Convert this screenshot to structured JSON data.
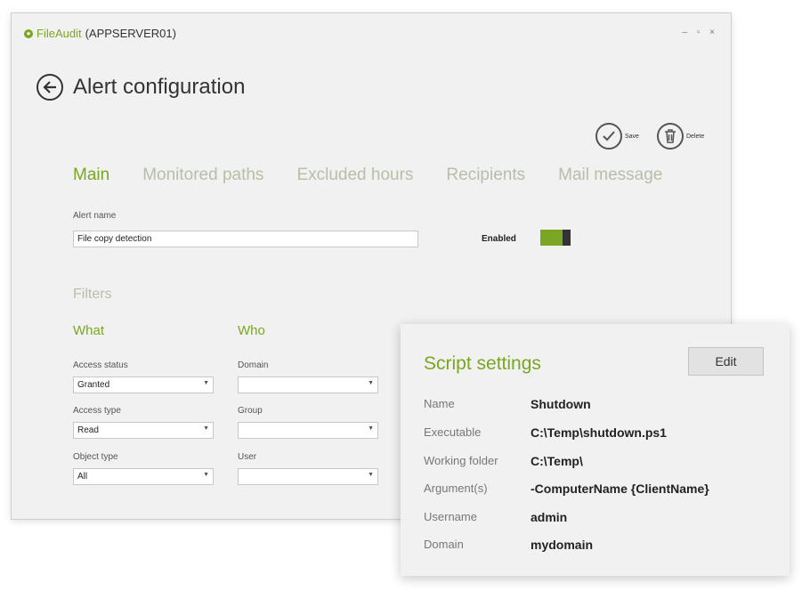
{
  "window": {
    "app_name": "FileAudit",
    "server": "(APPSERVER01)",
    "controls": "– ▫ ×"
  },
  "page": {
    "title": "Alert configuration"
  },
  "actions": {
    "save_label": "Save",
    "delete_label": "Delete"
  },
  "tabs": [
    {
      "label": "Main",
      "active": true
    },
    {
      "label": "Monitored paths"
    },
    {
      "label": "Excluded hours"
    },
    {
      "label": "Recipients"
    },
    {
      "label": "Mail message"
    }
  ],
  "alert": {
    "name_label": "Alert name",
    "name_value": "File copy detection",
    "enabled_label": "Enabled",
    "enabled": true
  },
  "filters": {
    "title": "Filters",
    "what": {
      "title": "What",
      "fields": [
        {
          "label": "Access status",
          "value": "Granted"
        },
        {
          "label": "Access type",
          "value": "Read"
        },
        {
          "label": "Object type",
          "value": "All"
        }
      ]
    },
    "who": {
      "title": "Who",
      "fields": [
        {
          "label": "Domain",
          "value": ""
        },
        {
          "label": "Group",
          "value": ""
        },
        {
          "label": "User",
          "value": ""
        }
      ]
    }
  },
  "script_settings": {
    "title": "Script settings",
    "edit_label": "Edit",
    "rows": [
      {
        "key": "Name",
        "value": "Shutdown"
      },
      {
        "key": "Executable",
        "value": "C:\\Temp\\shutdown.ps1"
      },
      {
        "key": "Working folder",
        "value": "C:\\Temp\\"
      },
      {
        "key": "Argument(s)",
        "value": "-ComputerName {ClientName}"
      },
      {
        "key": "Username",
        "value": "admin"
      },
      {
        "key": "Domain",
        "value": "mydomain"
      }
    ]
  },
  "colors": {
    "accent": "#7aa623",
    "inactive_tab": "#b7bea9"
  }
}
